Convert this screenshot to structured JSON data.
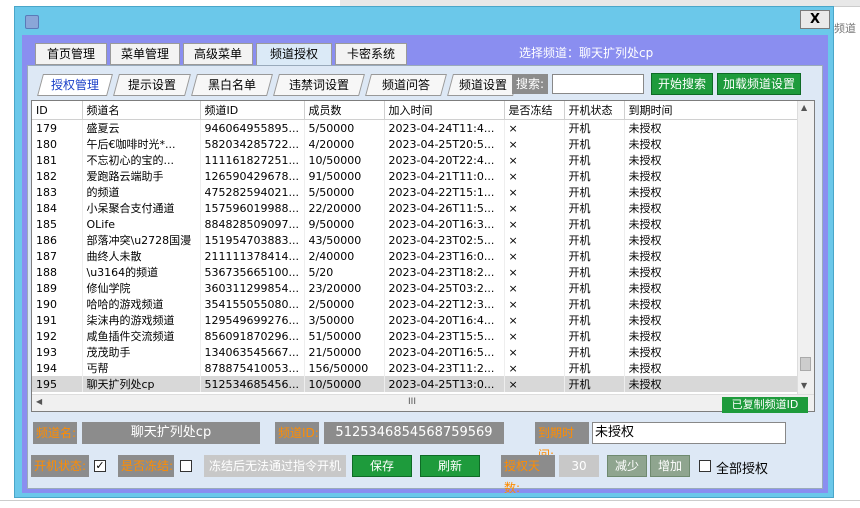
{
  "background": {
    "right_snippet": "频道"
  },
  "window": {
    "close_label": "X"
  },
  "main_tabs": [
    "首页管理",
    "菜单管理",
    "高级菜单",
    "频道授权",
    "卡密系统"
  ],
  "selected_channel": "选择频道：聊天扩列处cp",
  "sub_tabs": [
    "授权管理",
    "提示设置",
    "黑白名单",
    "违禁词设置",
    "频道问答",
    "频道设置"
  ],
  "search": {
    "label": "搜索:",
    "value": "",
    "start_button": "开始搜索",
    "load_button": "加载频道设置"
  },
  "table": {
    "columns": [
      "ID",
      "频道名",
      "频道ID",
      "成员数",
      "加入时间",
      "是否冻结",
      "开机状态",
      "到期时间"
    ],
    "rows": [
      [
        "179",
        "盛夏云",
        "946064955895...",
        "5/50000",
        "2023-04-24T11:4...",
        "×",
        "开机",
        "未授权"
      ],
      [
        "180",
        "午后€咖啡时光*...",
        "582034285722...",
        "4/20000",
        "2023-04-25T20:5...",
        "×",
        "开机",
        "未授权"
      ],
      [
        "181",
        "不忘初心的宝的...",
        "111161827251...",
        "10/50000",
        "2023-04-20T22:4...",
        "×",
        "开机",
        "未授权"
      ],
      [
        "182",
        "爱跑路云端助手",
        "126590429678...",
        "91/50000",
        "2023-04-21T11:0...",
        "×",
        "开机",
        "未授权"
      ],
      [
        "183",
        "的频道",
        "475282594021...",
        "5/50000",
        "2023-04-22T15:1...",
        "×",
        "开机",
        "未授权"
      ],
      [
        "184",
        "小呆聚合支付通道",
        "157596019988...",
        "22/20000",
        "2023-04-26T11:5...",
        "×",
        "开机",
        "未授权"
      ],
      [
        "185",
        "OLife",
        "884828509097...",
        "9/50000",
        "2023-04-20T16:3...",
        "×",
        "开机",
        "未授权"
      ],
      [
        "186",
        "部落冲突\\u2728国漫",
        "151954703883...",
        "43/50000",
        "2023-04-23T02:5...",
        "×",
        "开机",
        "未授权"
      ],
      [
        "187",
        "曲终人未散",
        "211111378414...",
        "2/40000",
        "2023-04-23T16:0...",
        "×",
        "开机",
        "未授权"
      ],
      [
        "188",
        "\\u3164的频道",
        "536735665100...",
        "5/20",
        "2023-04-23T18:2...",
        "×",
        "开机",
        "未授权"
      ],
      [
        "189",
        "修仙学院",
        "360311299854...",
        "23/20000",
        "2023-04-25T03:2...",
        "×",
        "开机",
        "未授权"
      ],
      [
        "190",
        "哈哈的游戏频道",
        "354155055080...",
        "2/50000",
        "2023-04-22T12:3...",
        "×",
        "开机",
        "未授权"
      ],
      [
        "191",
        "柒沫冉的游戏频道",
        "129549699276...",
        "3/50000",
        "2023-04-20T16:4...",
        "×",
        "开机",
        "未授权"
      ],
      [
        "192",
        "咸鱼插件交流频道",
        "856091870296...",
        "51/50000",
        "2023-04-23T15:5...",
        "×",
        "开机",
        "未授权"
      ],
      [
        "193",
        "茂茂助手",
        "134063545667...",
        "21/50000",
        "2023-04-20T16:5...",
        "×",
        "开机",
        "未授权"
      ],
      [
        "194",
        "丐帮",
        "878875410053...",
        "156/50000",
        "2023-04-23T11:2...",
        "×",
        "开机",
        "未授权"
      ],
      [
        "195",
        "聊天扩列处cp",
        "512534685456...",
        "10/50000",
        "2023-04-25T13:0...",
        "×",
        "开机",
        "未授权"
      ]
    ],
    "selected_row": 16,
    "h_thumb": "III",
    "copied_badge": "已复制频道ID"
  },
  "details": {
    "name_label": "频道名:",
    "name_value": "聊天扩列处cp",
    "id_label": "频道ID:",
    "id_value": "5125346854568759569",
    "expire_label": "到期时间:",
    "expire_value": "未授权",
    "power_label": "开机状态:",
    "power_checked": "✓",
    "frozen_label": "是否冻结:",
    "frozen_hint": "冻结后无法通过指令开机",
    "save_button": "保存",
    "refresh_button": "刷新",
    "days_label": "授权天数:",
    "days_value": "30",
    "decrease_button": "减少",
    "increase_button": "增加",
    "all_auth_label": "全部授权"
  },
  "colors": {
    "frame": "#6bc8ea",
    "client": "#8a8ef0",
    "green": "#1e9b3c",
    "orange_label": "#ff8c00"
  }
}
